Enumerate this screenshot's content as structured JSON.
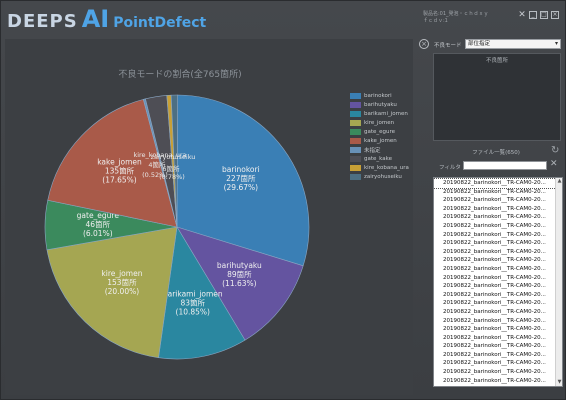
{
  "app": {
    "logo_part1": "DEEPS",
    "logo_part2": "AI",
    "logo_part3": "PointDefect",
    "info_line1": "製品名:01_発泡・ｃｈｄｘｙ",
    "info_line2": "ｆｃｄｖ:1",
    "window_buttons": [
      "pin-icon",
      "minimize-icon",
      "maximize-icon",
      "close-icon"
    ]
  },
  "colors": {
    "accent": "#4fa4e6",
    "background": "#3c3f43"
  },
  "chart_data": {
    "type": "pie",
    "title": "不良モードの割合(全765箇所)",
    "total": 765,
    "slices": [
      {
        "name": "barinokori",
        "count": 227,
        "count_label": "227箇所",
        "percent_label": "(29.67%)",
        "color": "#3a7fb5"
      },
      {
        "name": "barihutyaku",
        "count": 89,
        "count_label": "89箇所",
        "percent_label": "(11.63%)",
        "color": "#6454a0"
      },
      {
        "name": "barikami_jomen",
        "count": 83,
        "count_label": "83箇所",
        "percent_label": "(10.85%)",
        "color": "#2a87a0"
      },
      {
        "name": "kire_jomen",
        "count": 153,
        "count_label": "153箇所",
        "percent_label": "(20.00%)",
        "color": "#a5a652"
      },
      {
        "name": "gate_egure",
        "count": 46,
        "count_label": "46箇所",
        "percent_label": "(6.01%)",
        "color": "#3b8a5d"
      },
      {
        "name": "kake_jomen",
        "count": 135,
        "count_label": "135箇所",
        "percent_label": "(17.65%)",
        "color": "#a95a49"
      },
      {
        "name": "未指定",
        "count": 2,
        "count_label": "",
        "percent_label": "",
        "color": "#6891b8"
      },
      {
        "name": "gate_kake",
        "count": 20,
        "count_label": "",
        "percent_label": "",
        "color": "#4e4e55"
      },
      {
        "name": "kire_kobana_ura",
        "count": 4,
        "count_label": "",
        "percent_label": "",
        "color": "#c8a036"
      },
      {
        "name": "zairyohuseiku",
        "count": 6,
        "count_label": "",
        "percent_label": "",
        "color": "#4d6f82"
      }
    ],
    "crowded_labels": [
      "kire_kobana_ura",
      "zairyohuseiku",
      "4箇所",
      "6箇所",
      "(0.52%)",
      "(0.78%)"
    ]
  },
  "legend": {
    "placement": "right",
    "items": [
      {
        "label": "barinokori",
        "color": "#3a7fb5"
      },
      {
        "label": "barihutyaku",
        "color": "#6454a0"
      },
      {
        "label": "barikami_jomen",
        "color": "#2a87a0"
      },
      {
        "label": "kire_jomen",
        "color": "#a5a652"
      },
      {
        "label": "gate_egure",
        "color": "#3b8a5d"
      },
      {
        "label": "kake_jomen",
        "color": "#a95a49"
      },
      {
        "label": "未指定",
        "color": "#6891b8"
      },
      {
        "label": "gate_kake",
        "color": "#4e4e55"
      },
      {
        "label": "kire_kobana_ura",
        "color": "#c8a036"
      },
      {
        "label": "zairyohuseiku",
        "color": "#4d6f82"
      }
    ]
  },
  "side": {
    "mode_label": "不良モード",
    "mode_value": "部位指定",
    "defect_label": "不良箇所",
    "file_list_title": "ファイル一覧(650)",
    "filter_label": "フィルタ",
    "filter_value": "",
    "files": [
      "20190822_barinokori__TR-CAM0-20...",
      "20190822_barinokori__TR-CAM0-20...",
      "20190822_barinokori__TR-CAM0-20...",
      "20190822_barinokori__TR-CAM0-20...",
      "20190822_barinokori__TR-CAM0-20...",
      "20190822_barinokori__TR-CAM0-20...",
      "20190822_barinokori__TR-CAM0-20...",
      "20190822_barinokori__TR-CAM0-20...",
      "20190822_barinokori__TR-CAM0-20...",
      "20190822_barinokori__TR-CAM0-20...",
      "20190822_barinokori__TR-CAM0-20...",
      "20190822_barinokori__TR-CAM0-20...",
      "20190822_barinokori__TR-CAM0-20...",
      "20190822_barinokori__TR-CAM0-20...",
      "20190822_barinokori__TR-CAM0-20...",
      "20190822_barinokori__TR-CAM0-20...",
      "20190822_barinokori__TR-CAM0-20...",
      "20190822_barinokori__TR-CAM0-20...",
      "20190822_barinokori__TR-CAM0-20...",
      "20190822_barinokori__TR-CAM0-20...",
      "20190822_barinokori__TR-CAM0-20...",
      "20190822_barinokori__TR-CAM0-20...",
      "20190822_barinokori__TR-CAM0-20...",
      "20190822_barinokori__TR-CAM0-20..."
    ]
  }
}
